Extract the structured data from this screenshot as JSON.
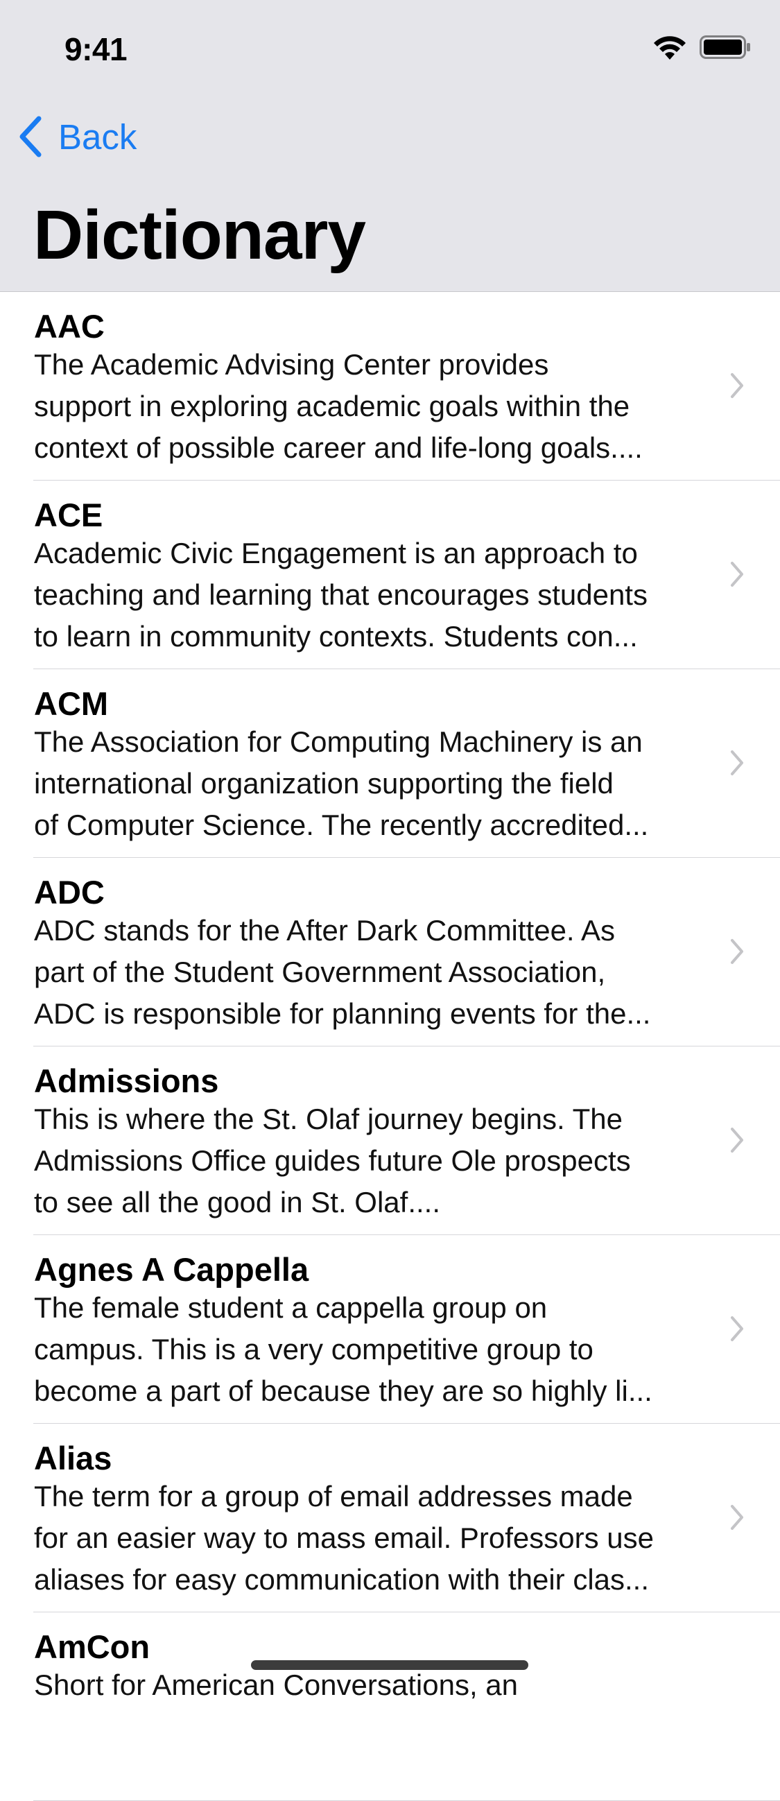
{
  "status_bar": {
    "time": "9:41"
  },
  "nav": {
    "back_label": "Back",
    "title": "Dictionary"
  },
  "colors": {
    "accent": "#1a7cf2",
    "header_bg": "#e5e5ea",
    "separator": "#d6d6da"
  },
  "icons": {
    "back": "chevron-left-icon",
    "row": "chevron-right-icon",
    "wifi": "wifi-icon",
    "battery": "battery-icon"
  },
  "entries": [
    {
      "title": "AAC",
      "lines": [
        "The Academic Advising Center provides",
        "support in exploring academic goals within the",
        "context of possible career and life-long goals...."
      ]
    },
    {
      "title": "ACE",
      "lines": [
        "Academic Civic Engagement is an approach to",
        "teaching and learning that encourages students",
        "to learn in community contexts. Students con..."
      ]
    },
    {
      "title": "ACM",
      "lines": [
        "The Association for Computing Machinery is an",
        "international organization supporting the field",
        "of Computer Science. The recently accredited..."
      ]
    },
    {
      "title": "ADC",
      "lines": [
        "ADC stands for the After Dark Committee. As",
        "part of the Student Government Association,",
        "ADC is responsible for planning events for the..."
      ]
    },
    {
      "title": "Admissions",
      "lines": [
        "This is where the St. Olaf journey begins. The",
        "Admissions Office guides future Ole prospects",
        "to see all the good in St. Olaf...."
      ]
    },
    {
      "title": "Agnes A Cappella",
      "lines": [
        "The female student a cappella group on",
        "campus. This is a very competitive group to",
        "become a part of because they are so highly li..."
      ]
    },
    {
      "title": "Alias",
      "lines": [
        "The term for a group of email addresses made",
        "for an easier way to mass email. Professors use",
        "aliases for easy communication with their clas..."
      ]
    },
    {
      "title": "AmCon",
      "lines": [
        "Short for American Conversations, an"
      ]
    }
  ]
}
